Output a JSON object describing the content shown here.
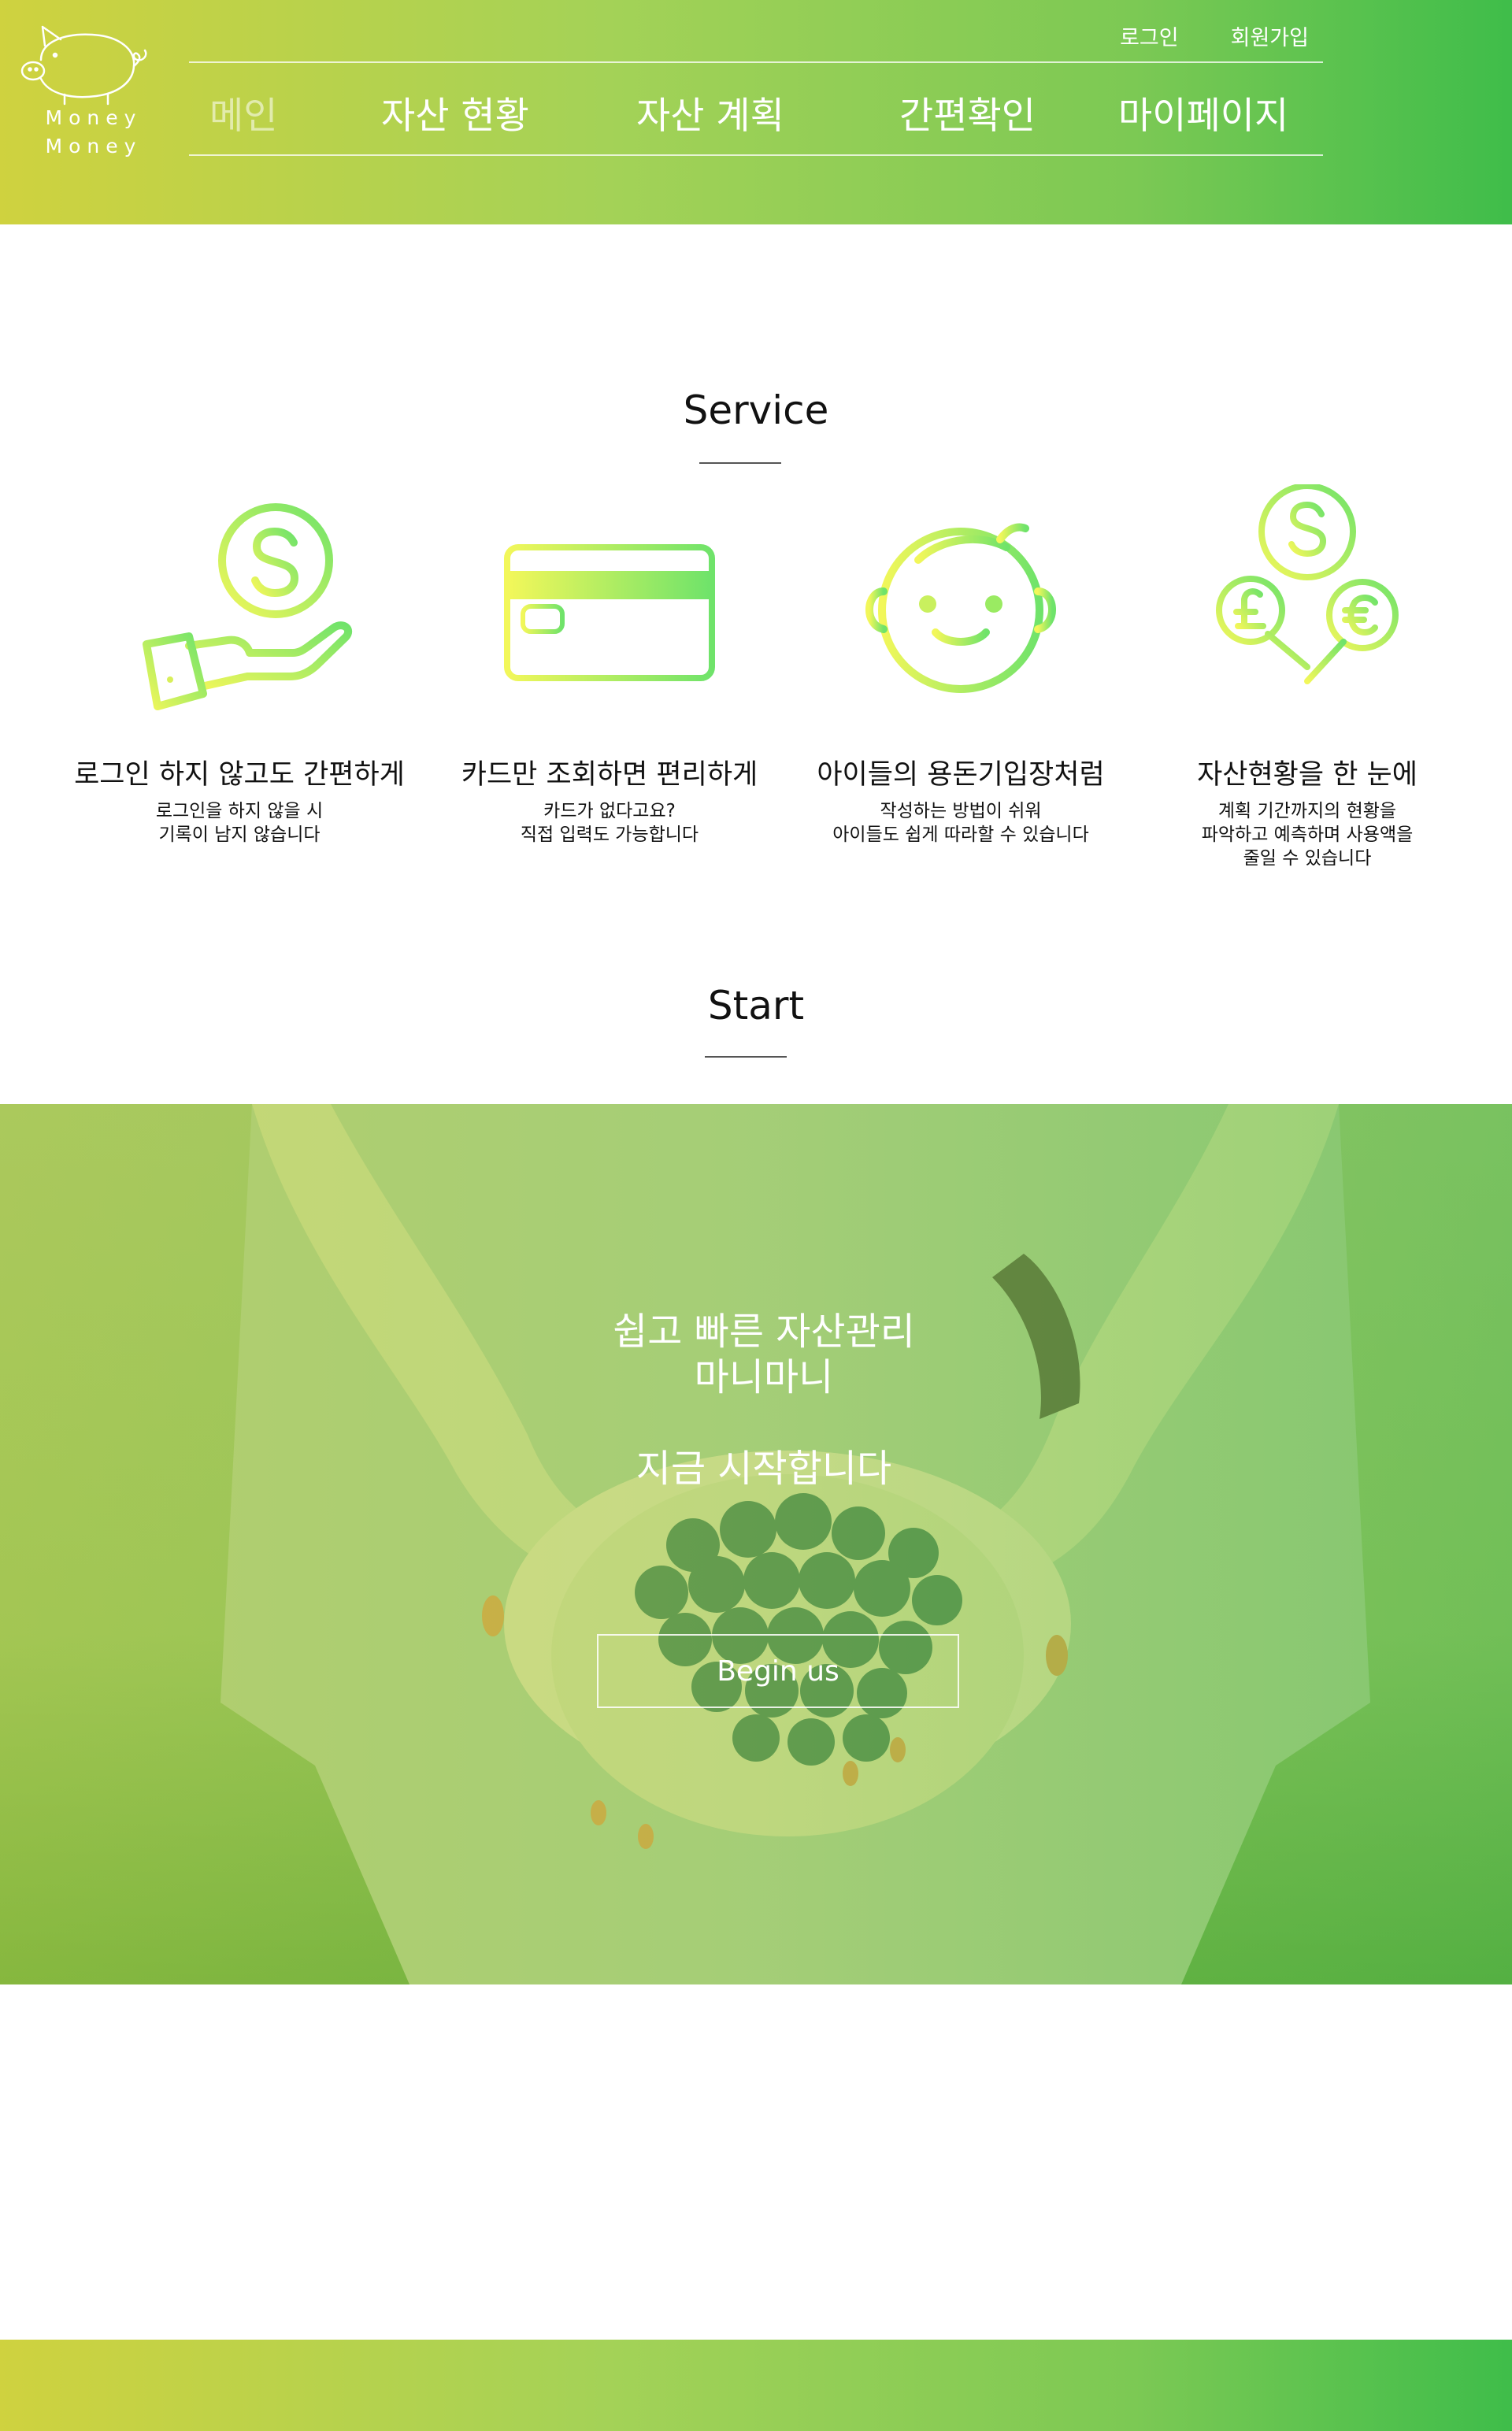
{
  "brand": {
    "logo_line1": "Money",
    "logo_line2": "Money"
  },
  "colors": {
    "gradient_start": "#cfd23f",
    "gradient_end": "#3fbd4a",
    "icon_yellow": "#e8f75a",
    "icon_green": "#6fe36a"
  },
  "header": {
    "top_links": {
      "login": "로그인",
      "signup": "회원가입"
    },
    "nav": {
      "main": "메인",
      "asset_status": "자산 현황",
      "asset_plan": "자산 계획",
      "quick_check": "간편확인",
      "mypage": "마이페이지"
    }
  },
  "service": {
    "title": "Service",
    "items": [
      {
        "icon": "hand-dollar-icon",
        "heading": "로그인 하지 않고도 간편하게",
        "desc": "로그인을 하지 않을 시\n기록이 남지 않습니다"
      },
      {
        "icon": "card-icon",
        "heading": "카드만 조회하면 편리하게",
        "desc": "카드가 없다고요?\n직접 입력도 가능합니다"
      },
      {
        "icon": "child-face-icon",
        "heading": "아이들의 용돈기입장처럼",
        "desc": "작성하는 방법이 쉬워\n아이들도 쉽게 따라할 수 있습니다"
      },
      {
        "icon": "money-tree-icon",
        "heading": "자산현황을 한 눈에",
        "desc": "계획 기간까지의 현황을\n파악하고 예측하며 사용액을\n줄일 수 있습니다"
      }
    ]
  },
  "start": {
    "title": "Start",
    "line1": "쉽고 빠른 자산관리",
    "line2": "마니마니",
    "line3": "지금 시작합니다",
    "button": "Begin us"
  }
}
